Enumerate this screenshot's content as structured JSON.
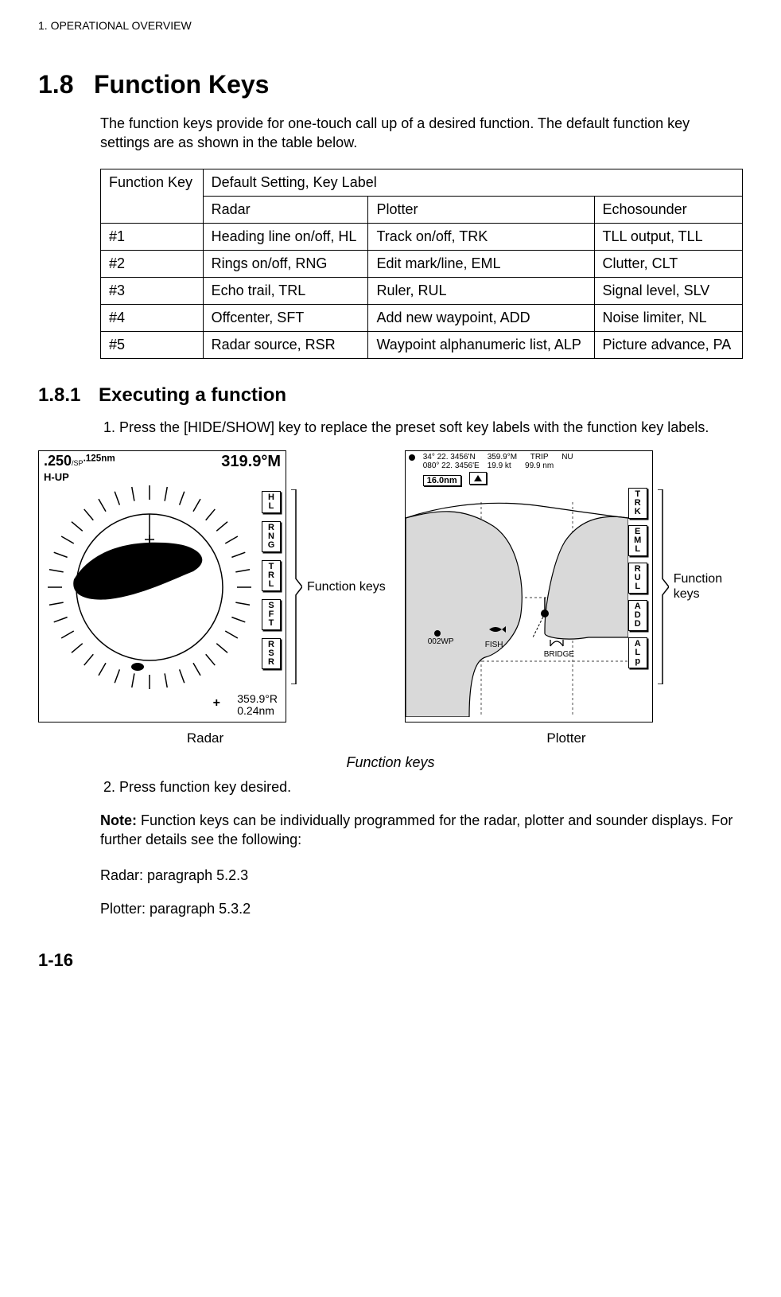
{
  "header": "1. OPERATIONAL OVERVIEW",
  "section": {
    "num": "1.8",
    "title": "Function Keys"
  },
  "intro": "The function keys provide for one-touch call up of a desired function. The default function key settings are as shown in the table below.",
  "table": {
    "col_key": "Function Key",
    "col_setting": "Default Setting, Key Label",
    "sub_radar": "Radar",
    "sub_plotter": "Plotter",
    "sub_echo": "Echosounder",
    "rows": [
      {
        "key": "#1",
        "radar": "Heading line on/off, HL",
        "plotter": "Track on/off, TRK",
        "echo": "TLL output, TLL"
      },
      {
        "key": "#2",
        "radar": "Rings on/off, RNG",
        "plotter": "Edit mark/line, EML",
        "echo": "Clutter, CLT"
      },
      {
        "key": "#3",
        "radar": "Echo trail, TRL",
        "plotter": "Ruler, RUL",
        "echo": "Signal level, SLV"
      },
      {
        "key": "#4",
        "radar": "Offcenter, SFT",
        "plotter": "Add new waypoint, ADD",
        "echo": "Noise limiter, NL"
      },
      {
        "key": "#5",
        "radar": "Radar source, RSR",
        "plotter": "Waypoint alphanumeric list, ALP",
        "echo": "Picture advance, PA"
      }
    ]
  },
  "subsection": {
    "num": "1.8.1",
    "title": "Executing a function"
  },
  "steps": {
    "s1": "Press the [HIDE/SHOW] key to replace the preset soft key labels with the function key labels.",
    "s2": "Press function key desired."
  },
  "radar": {
    "range": ".250",
    "range_sub": "/SP",
    "range_sup": ".125nm",
    "heading": "319.9°M",
    "mode": "H-UP",
    "keys": [
      "HL",
      "RNG",
      "TRL",
      "SFT",
      "RSR"
    ],
    "bearing": "359.9°R",
    "dist": "0.24nm",
    "caption": "Radar"
  },
  "plotter": {
    "lat": "34° 22. 3456'N",
    "lon": "080° 22. 3456'E",
    "brg": "359.9°M",
    "spd": "19.9 kt",
    "trip_lbl": "TRIP",
    "trip": "99.9 nm",
    "nu": "NU",
    "range_chip": "16.0nm",
    "wp_002": "002WP",
    "fish": "FISH",
    "bridge": "BRIDGE",
    "keys": [
      "TRK",
      "EML",
      "RUL",
      "ADD",
      "ALp"
    ],
    "caption": "Plotter"
  },
  "fk_label": "Function keys",
  "fig_caption": "Function keys",
  "note_prefix": "Note:",
  "note_body": " Function keys can be individually programmed for the radar, plotter and sounder displays. For further details see the following:",
  "ref_radar": "Radar: paragraph 5.2.3",
  "ref_plotter": "Plotter: paragraph 5.3.2",
  "page_num": "1-16"
}
